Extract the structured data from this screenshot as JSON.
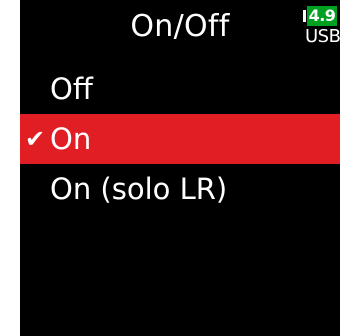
{
  "header": {
    "title": "On/Off",
    "battery": {
      "level_text": "4.9",
      "source": "USB",
      "color": "#00a020"
    }
  },
  "menu": {
    "items": [
      {
        "label": "Off",
        "selected": false
      },
      {
        "label": "On",
        "selected": true,
        "check_icon": "checkmark-icon"
      },
      {
        "label": "On (solo LR)",
        "selected": false
      }
    ],
    "selected_color": "#e01e24"
  }
}
